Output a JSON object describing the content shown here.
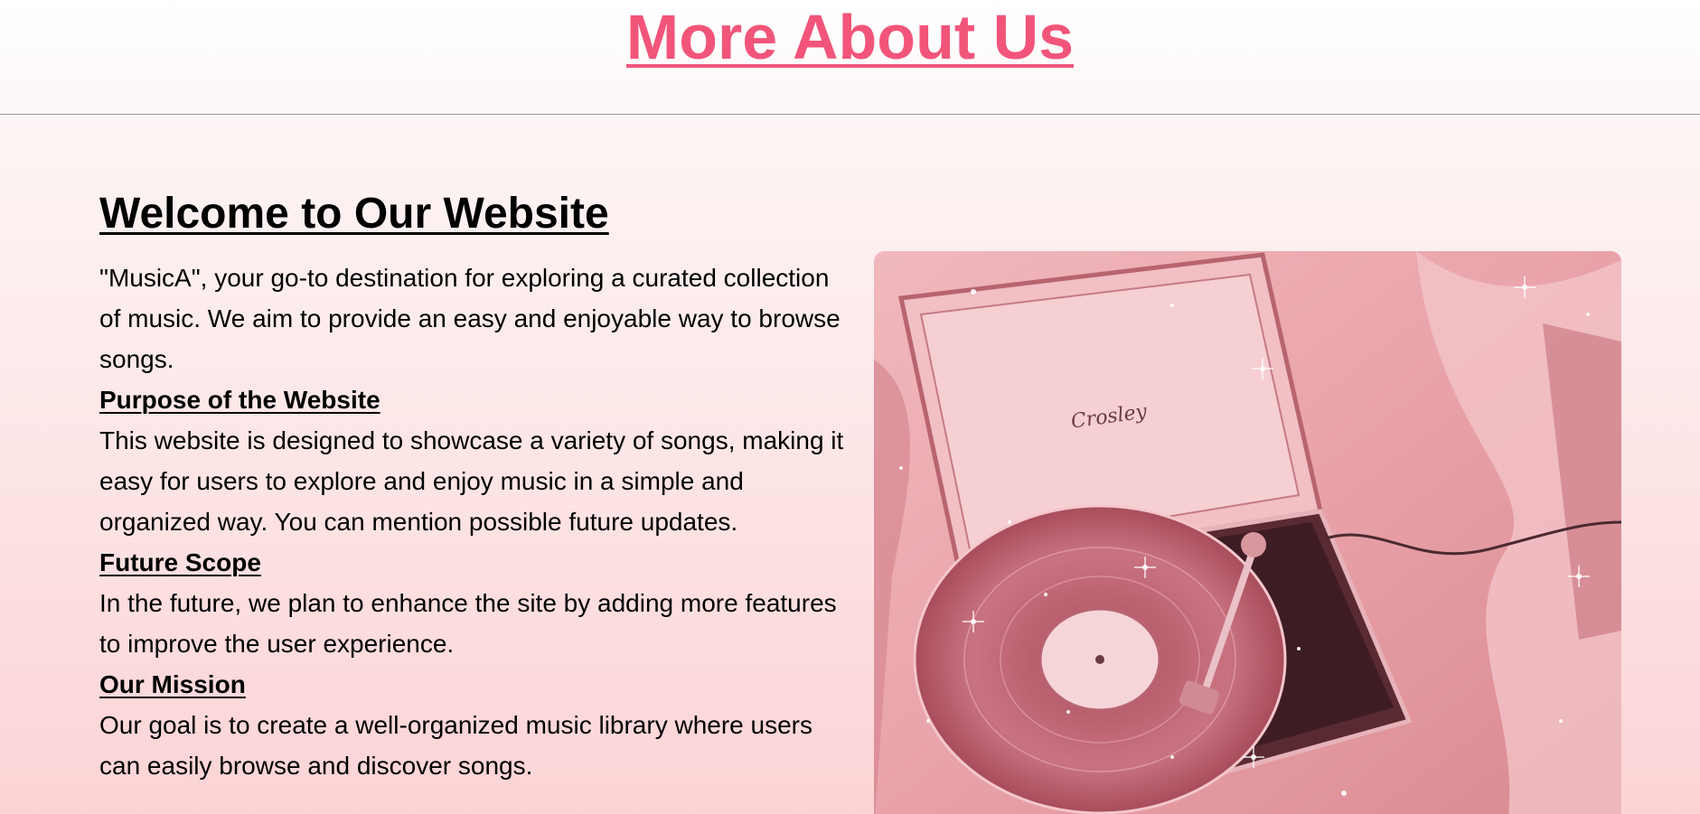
{
  "header": {
    "title": "More About Us"
  },
  "main": {
    "welcome_heading": "Welcome to Our Website",
    "intro": "\"MusicA\", your go-to destination for exploring a curated collection of music. We aim to provide an easy and enjoyable way to browse songs.",
    "sections": [
      {
        "heading": "Purpose of the Website",
        "body": "This website is designed to showcase a variety of songs, making it easy for users to explore and enjoy music in a simple and organized way. You can mention possible future updates."
      },
      {
        "heading": "Future Scope",
        "body": "In the future, we plan to enhance the site by adding more features to improve the user experience."
      },
      {
        "heading": "Our Mission",
        "body": "Our goal is to create a well-organized music library where users can easily browse and discover songs."
      }
    ]
  },
  "image": {
    "brand_text": "Crosley"
  },
  "colors": {
    "title": "#f2557a",
    "background_top": "#ffffff",
    "background_bottom": "#fcd3d5",
    "divider": "#9a9a9a"
  }
}
